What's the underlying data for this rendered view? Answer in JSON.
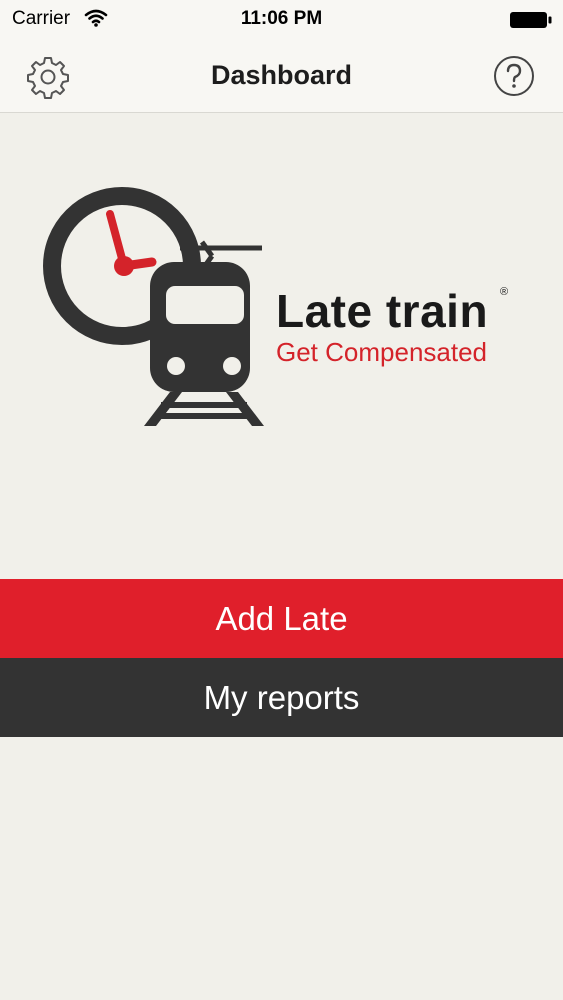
{
  "status_bar": {
    "carrier": "Carrier",
    "time": "11:06 PM"
  },
  "nav": {
    "title": "Dashboard",
    "left_icon": "gear-icon",
    "right_icon": "question-icon"
  },
  "logo": {
    "title": "Late train",
    "registered_mark": "®",
    "subtitle": "Get Compensated"
  },
  "actions": {
    "add_late": "Add Late",
    "my_reports": "My reports"
  },
  "colors": {
    "accent_red": "#e01f2b",
    "dark": "#333333",
    "background": "#f1f0ea"
  }
}
